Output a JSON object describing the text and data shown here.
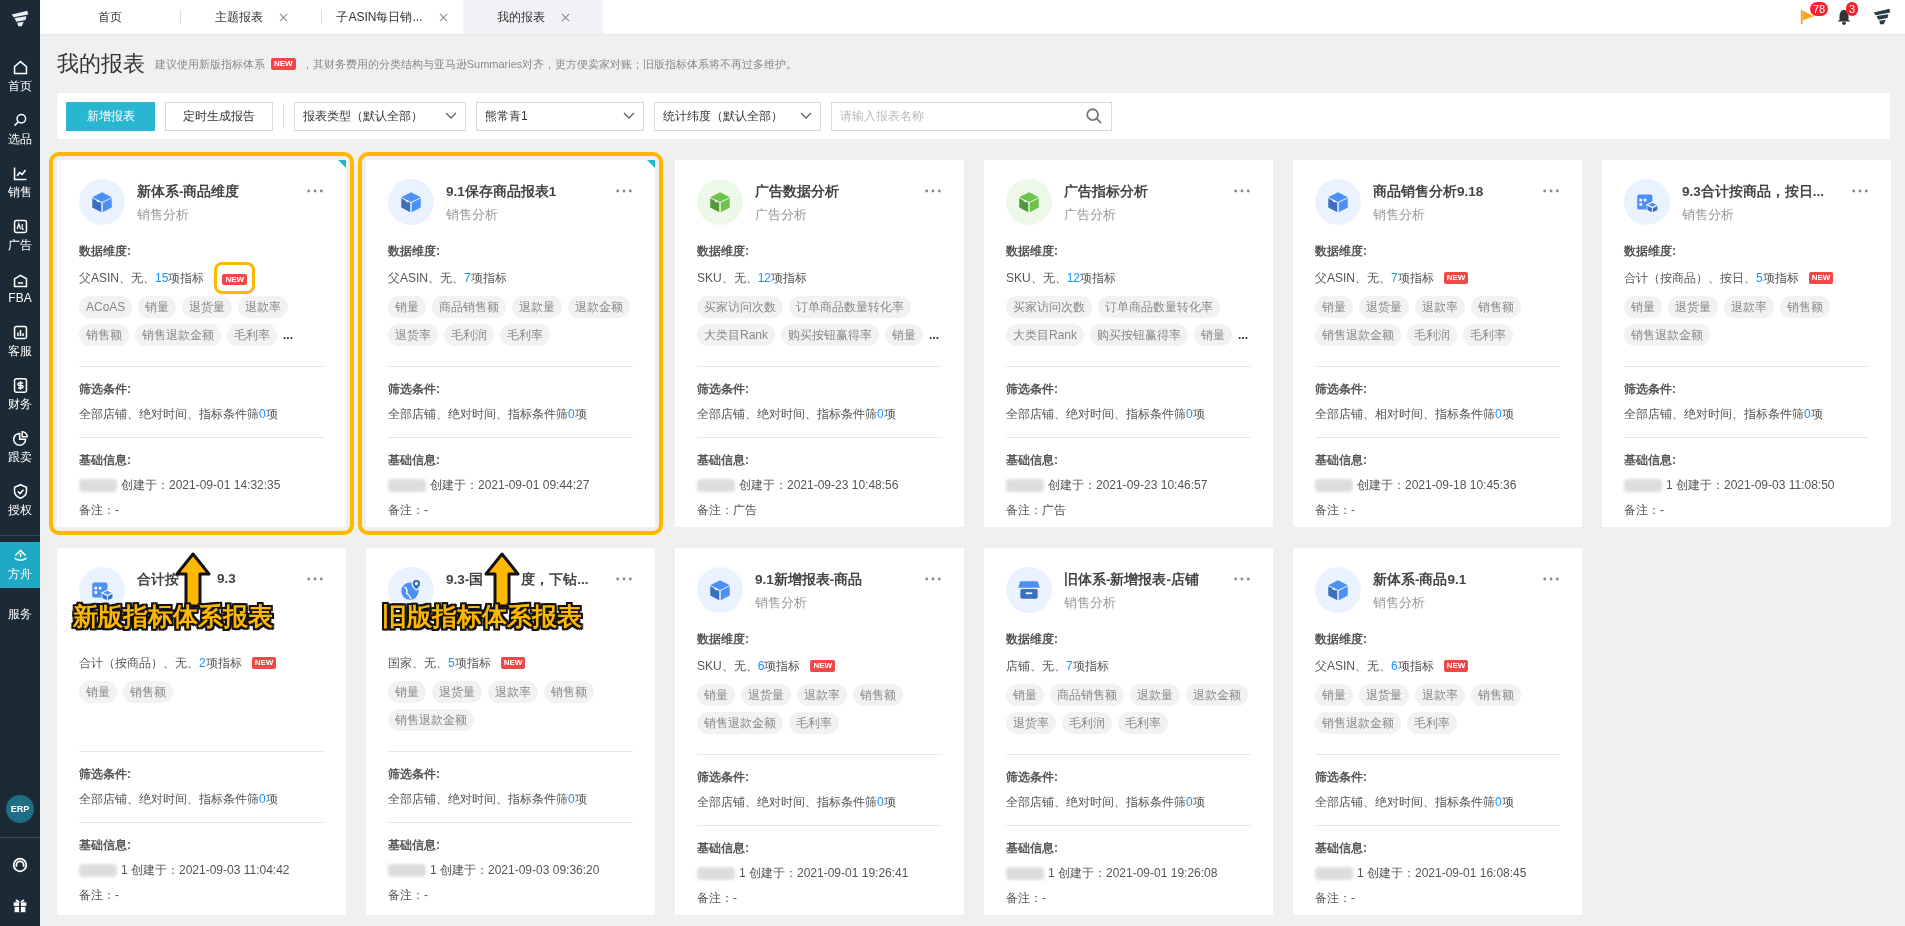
{
  "sidebar": {
    "items": [
      {
        "label": "首页",
        "kind": "home",
        "selected": false
      },
      {
        "label": "选品",
        "kind": "search",
        "selected": false
      },
      {
        "label": "销售",
        "kind": "chart",
        "selected": false
      },
      {
        "label": "广告",
        "kind": "ad",
        "selected": false
      },
      {
        "label": "FBA",
        "kind": "fba",
        "selected": false
      },
      {
        "label": "客服",
        "kind": "bars",
        "selected": false
      },
      {
        "label": "财务",
        "kind": "money",
        "selected": false
      },
      {
        "label": "跟卖",
        "kind": "pie",
        "selected": false
      },
      {
        "label": "授权",
        "kind": "shield",
        "selected": false
      },
      {
        "label": "方舟",
        "kind": "ark",
        "selected": true
      },
      {
        "label": "服务",
        "kind": "text",
        "selected": false
      }
    ],
    "erp": "ERP"
  },
  "tabs": [
    {
      "label": "首页",
      "closable": false,
      "selected": false
    },
    {
      "label": "主题报表",
      "closable": true,
      "selected": false
    },
    {
      "label": "子ASIN每日销...",
      "closable": true,
      "selected": false
    },
    {
      "label": "我的报表",
      "closable": true,
      "selected": true
    }
  ],
  "top_right": {
    "flag_badge": "78",
    "bell_badge": "3"
  },
  "header": {
    "title": "我的报表",
    "hint_before": "建议使用新版指标体系",
    "hint_badge": "NEW",
    "hint_after": "，其财务费用的分类结构与亚马逊Summaries对齐，更方便卖家对账；旧版指标体系将不再过多维护。"
  },
  "toolbar": {
    "primary_button": "新增报表",
    "secondary_button": "定时生成报告",
    "selects": [
      {
        "value": "报表类型（默认全部）"
      },
      {
        "value": "熊常青1"
      },
      {
        "value": "统计纬度（默认全部）"
      }
    ],
    "search": {
      "placeholder": "请输入报表名称"
    }
  },
  "cards": [
    {
      "title_parts": [
        "新体系-商品维度"
      ],
      "subtitle": "销售分析",
      "kind": "cube",
      "color": "#4b8ff7",
      "highlighted": true,
      "corner_mark": true,
      "dims_label": "数据维度:",
      "dims_prefix": "父ASIN、无、",
      "dims_count": "15",
      "dims_suffix": "项指标",
      "new_badge": "NEW",
      "badge_ringed": true,
      "tags": [
        "ACoAS",
        "销量",
        "退货量",
        "退款率",
        "销售额",
        "销售退款金额",
        "毛利率"
      ],
      "tags_more": "...",
      "filter_label": "筛选条件:",
      "filter_prefix": "全部店铺、绝对时间、指标条件筛",
      "filter_count": "0",
      "filter_suffix": "项",
      "info_label": "基础信息:",
      "created": "创建于：2021-09-01 14:32:35",
      "remark": "备注：-"
    },
    {
      "title_parts": [
        "9.1保存商品报表1"
      ],
      "subtitle": "销售分析",
      "kind": "cube",
      "color": "#4b8ff7",
      "highlighted": true,
      "corner_mark": true,
      "dims_label": "数据维度:",
      "dims_prefix": "父ASIN、无、",
      "dims_count": "7",
      "dims_suffix": "项指标",
      "tags": [
        "销量",
        "商品销售额",
        "退款量",
        "退款金额",
        "退货率",
        "毛利润",
        "毛利率"
      ],
      "filter_label": "筛选条件:",
      "filter_prefix": "全部店铺、绝对时间、指标条件筛",
      "filter_count": "0",
      "filter_suffix": "项",
      "info_label": "基础信息:",
      "created": "创建于：2021-09-01 09:44:27",
      "remark": "备注：-"
    },
    {
      "title_parts": [
        "广告数据分析"
      ],
      "subtitle": "广告分析",
      "kind": "cube",
      "color": "#6cc24a",
      "highlighted": false,
      "corner_mark": false,
      "dims_label": "数据维度:",
      "dims_prefix": "SKU、无、",
      "dims_count": "12",
      "dims_suffix": "项指标",
      "tags": [
        "买家访问次数",
        "订单商品数量转化率",
        "大类目Rank",
        "购买按钮赢得率",
        "销量"
      ],
      "tags_more": "...",
      "filter_label": "筛选条件:",
      "filter_prefix": "全部店铺、绝对时间、指标条件筛",
      "filter_count": "0",
      "filter_suffix": "项",
      "info_label": "基础信息:",
      "created": "创建于：2021-09-23 10:48:56",
      "remark": "备注：广告"
    },
    {
      "title_parts": [
        "广告指标分析"
      ],
      "subtitle": "广告分析",
      "kind": "cube",
      "color": "#6cc24a",
      "highlighted": false,
      "corner_mark": false,
      "dims_label": "数据维度:",
      "dims_prefix": "SKU、无、",
      "dims_count": "12",
      "dims_suffix": "项指标",
      "tags": [
        "买家访问次数",
        "订单商品数量转化率",
        "大类目Rank",
        "购买按钮赢得率",
        "销量"
      ],
      "tags_more": "...",
      "filter_label": "筛选条件:",
      "filter_prefix": "全部店铺、绝对时间、指标条件筛",
      "filter_count": "0",
      "filter_suffix": "项",
      "info_label": "基础信息:",
      "created": "创建于：2021-09-23 10:46:57",
      "remark": "备注：广告"
    },
    {
      "title_parts": [
        "商品销售分析9.18"
      ],
      "subtitle": "销售分析",
      "kind": "cube",
      "color": "#4b8ff7",
      "highlighted": false,
      "corner_mark": false,
      "dims_label": "数据维度:",
      "dims_prefix": "父ASIN、无、",
      "dims_count": "7",
      "dims_suffix": "项指标",
      "new_badge": "NEW",
      "tags": [
        "销量",
        "退货量",
        "退款率",
        "销售额",
        "销售退款金额",
        "毛利润",
        "毛利率"
      ],
      "filter_label": "筛选条件:",
      "filter_prefix": "全部店铺、相对时间、指标条件筛",
      "filter_count": "0",
      "filter_suffix": "项",
      "info_label": "基础信息:",
      "created": "创建于：2021-09-18 10:45:36",
      "remark": "备注：-"
    },
    {
      "title_parts": [
        "9.3合计按商品，按日..."
      ],
      "subtitle": "销售分析",
      "kind": "calendar",
      "color": "#4b8ff7",
      "highlighted": false,
      "corner_mark": false,
      "dims_label": "数据维度:",
      "dims_prefix": "合计（按商品）、按日、",
      "dims_count": "5",
      "dims_suffix": "项指标",
      "new_badge": "NEW",
      "tags": [
        "销量",
        "退货量",
        "退款率",
        "销售额",
        "销售退款金额"
      ],
      "filter_label": "筛选条件:",
      "filter_prefix": "全部店铺、绝对时间、指标条件筛",
      "filter_count": "0",
      "filter_suffix": "项",
      "info_label": "基础信息:",
      "created": "1 创建于：2021-09-03 11:08:50",
      "remark": "备注：-"
    },
    {
      "title_parts": [
        "合计按",
        "9.3"
      ],
      "kind": "calendar",
      "color": "#4b8ff7",
      "highlighted": false,
      "corner_mark": false,
      "annotation": "新版指标体系报表",
      "dims_prefix": "合计（按商品）、无、",
      "dims_count": "2",
      "dims_suffix": "项指标",
      "new_badge": "NEW",
      "tags": [
        "销量",
        "销售额"
      ],
      "filter_label": "筛选条件:",
      "filter_prefix": "全部店铺、绝对时间、指标条件筛",
      "filter_count": "0",
      "filter_suffix": "项",
      "info_label": "基础信息:",
      "created": "1 创建于：2021-09-03 11:04:42",
      "remark": "备注：-"
    },
    {
      "title_parts": [
        "9.3-国",
        "度，下钻..."
      ],
      "kind": "globe",
      "color": "#4b8ff7",
      "highlighted": false,
      "corner_mark": false,
      "annotation": "旧版指标体系报表",
      "dims_prefix": "国家、无、",
      "dims_count": "5",
      "dims_suffix": "项指标",
      "new_badge": "NEW",
      "tags": [
        "销量",
        "退货量",
        "退款率",
        "销售额",
        "销售退款金额"
      ],
      "filter_label": "筛选条件:",
      "filter_prefix": "全部店铺、绝对时间、指标条件筛",
      "filter_count": "0",
      "filter_suffix": "项",
      "info_label": "基础信息:",
      "created": "1 创建于：2021-09-03 09:36:20",
      "remark": "备注：-"
    },
    {
      "title_parts": [
        "9.1新增报表-商品"
      ],
      "subtitle": "销售分析",
      "kind": "cube",
      "color": "#4b8ff7",
      "highlighted": false,
      "corner_mark": false,
      "dims_label": "数据维度:",
      "dims_prefix": "SKU、无、",
      "dims_count": "6",
      "dims_suffix": "项指标",
      "new_badge": "NEW",
      "tags": [
        "销量",
        "退货量",
        "退款率",
        "销售额",
        "销售退款金额",
        "毛利率"
      ],
      "filter_label": "筛选条件:",
      "filter_prefix": "全部店铺、绝对时间、指标条件筛",
      "filter_count": "0",
      "filter_suffix": "项",
      "info_label": "基础信息:",
      "created": "1 创建于：2021-09-01 19:26:41",
      "remark": "备注：-"
    },
    {
      "title_parts": [
        "旧体系-新增报表-店铺"
      ],
      "subtitle": "销售分析",
      "kind": "store",
      "color": "#4b8ff7",
      "highlighted": false,
      "corner_mark": false,
      "dims_label": "数据维度:",
      "dims_prefix": "店铺、无、",
      "dims_count": "7",
      "dims_suffix": "项指标",
      "tags": [
        "销量",
        "商品销售额",
        "退款量",
        "退款金额",
        "退货率",
        "毛利润",
        "毛利率"
      ],
      "filter_label": "筛选条件:",
      "filter_prefix": "全部店铺、绝对时间、指标条件筛",
      "filter_count": "0",
      "filter_suffix": "项",
      "info_label": "基础信息:",
      "created": "1 创建于：2021-09-01 19:26:08",
      "remark": "备注：-"
    },
    {
      "title_parts": [
        "新体系-商品9.1"
      ],
      "subtitle": "销售分析",
      "kind": "cube",
      "color": "#4b8ff7",
      "highlighted": false,
      "corner_mark": false,
      "dims_label": "数据维度:",
      "dims_prefix": "父ASIN、无、",
      "dims_count": "6",
      "dims_suffix": "项指标",
      "new_badge": "NEW",
      "tags": [
        "销量",
        "退货量",
        "退款率",
        "销售额",
        "销售退款金额",
        "毛利率"
      ],
      "filter_label": "筛选条件:",
      "filter_prefix": "全部店铺、绝对时间、指标条件筛",
      "filter_count": "0",
      "filter_suffix": "项",
      "info_label": "基础信息:",
      "created": "1 创建于：2021-09-01 16:08:45",
      "remark": "备注：-"
    }
  ]
}
